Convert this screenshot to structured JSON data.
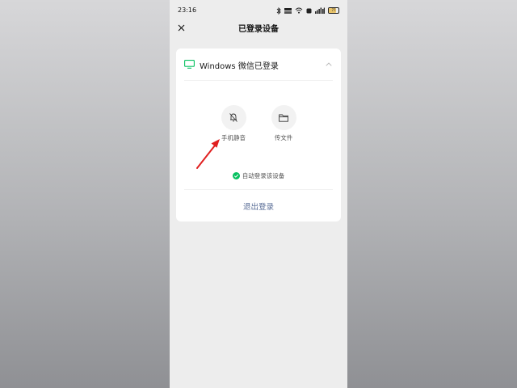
{
  "status_bar": {
    "time": "23:16",
    "battery": "77"
  },
  "nav": {
    "title": "已登录设备"
  },
  "device": {
    "title": "Windows 微信已登录"
  },
  "actions": [
    {
      "label": "手机静音",
      "icon": "bell-off-icon"
    },
    {
      "label": "传文件",
      "icon": "folder-icon"
    }
  ],
  "auto_login": {
    "label": "自动登录该设备",
    "checked": true
  },
  "logout": {
    "label": "退出登录"
  },
  "colors": {
    "accent_green": "#07c160",
    "link_blue": "#576b95",
    "arrow_red": "#e02020"
  }
}
